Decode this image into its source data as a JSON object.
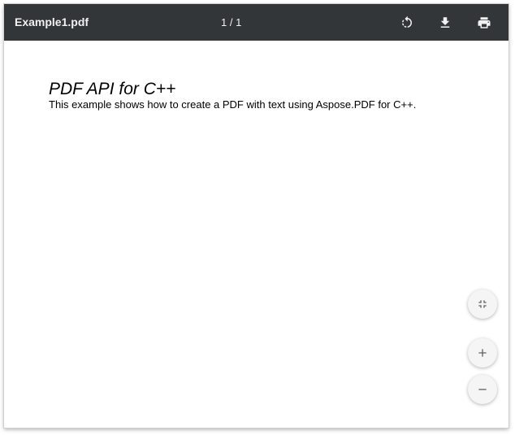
{
  "toolbar": {
    "title": "Example1.pdf",
    "page_counter": "1 / 1",
    "icons": {
      "rotate": "rotate-icon",
      "download": "download-icon",
      "print": "print-icon"
    },
    "background_color": "#323639"
  },
  "document": {
    "heading": "PDF API for C++",
    "body": "This example shows how to create a PDF with text using Aspose.PDF for C++."
  },
  "controls": {
    "icons": {
      "fit": "fit-to-page-icon",
      "zoom_in": "zoom-in-icon",
      "zoom_out": "zoom-out-icon"
    }
  }
}
